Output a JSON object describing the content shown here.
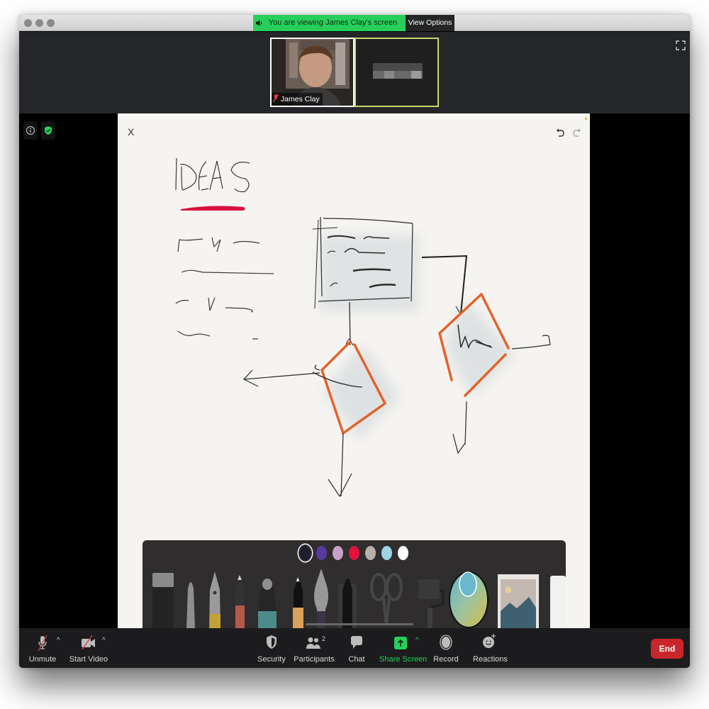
{
  "window": {
    "traffic_lights": [
      "close",
      "minimize",
      "zoom"
    ]
  },
  "banner": {
    "viewing_text": "You are viewing James Clay's screen",
    "view_options_label": "View Options",
    "view_options_chevron": "⌄",
    "accent_color": "#27cf5a"
  },
  "gallery": {
    "participants": [
      {
        "name": "James Clay",
        "muted": true,
        "video": "on",
        "speaking": false
      },
      {
        "name": "",
        "muted": false,
        "video": "blurred",
        "speaking": true
      }
    ]
  },
  "canvas": {
    "close_label": "X",
    "undo_icon": "undo-icon",
    "redo_icon": "redo-icon",
    "heading": "IDEAS",
    "shape_labels": [
      "Idea",
      "Idea"
    ],
    "stroke_colors": {
      "ink": "#2a2a2a",
      "underline": "#d9123f",
      "diamond": "#e2632a"
    }
  },
  "toolbox": {
    "colors": [
      "#1e1e2e",
      "#5a3aa0",
      "#c7a0c8",
      "#e2123a",
      "#b8b1aa",
      "#9fd3e6",
      "#ffffff"
    ],
    "selected_color_index": 0,
    "tools": [
      "eraser",
      "pencil",
      "fountain-pen",
      "colored-pencil",
      "marker",
      "fine-pen",
      "brush",
      "ruler-pen",
      "scissors",
      "roller",
      "color-picker",
      "image",
      "paper"
    ]
  },
  "controls": {
    "left": [
      {
        "label": "Unmute",
        "icon": "mic-off-icon"
      },
      {
        "label": "Start Video",
        "icon": "video-off-icon"
      }
    ],
    "center": [
      {
        "label": "Security",
        "icon": "shield-icon"
      },
      {
        "label": "Participants",
        "icon": "participants-icon",
        "count": "2"
      },
      {
        "label": "Chat",
        "icon": "chat-icon"
      },
      {
        "label": "Share Screen",
        "icon": "share-screen-icon"
      },
      {
        "label": "Record",
        "icon": "record-icon"
      },
      {
        "label": "Reactions",
        "icon": "reactions-icon"
      }
    ],
    "end_label": "End",
    "share_color": "#27cf5a",
    "end_color": "#c9262b"
  }
}
